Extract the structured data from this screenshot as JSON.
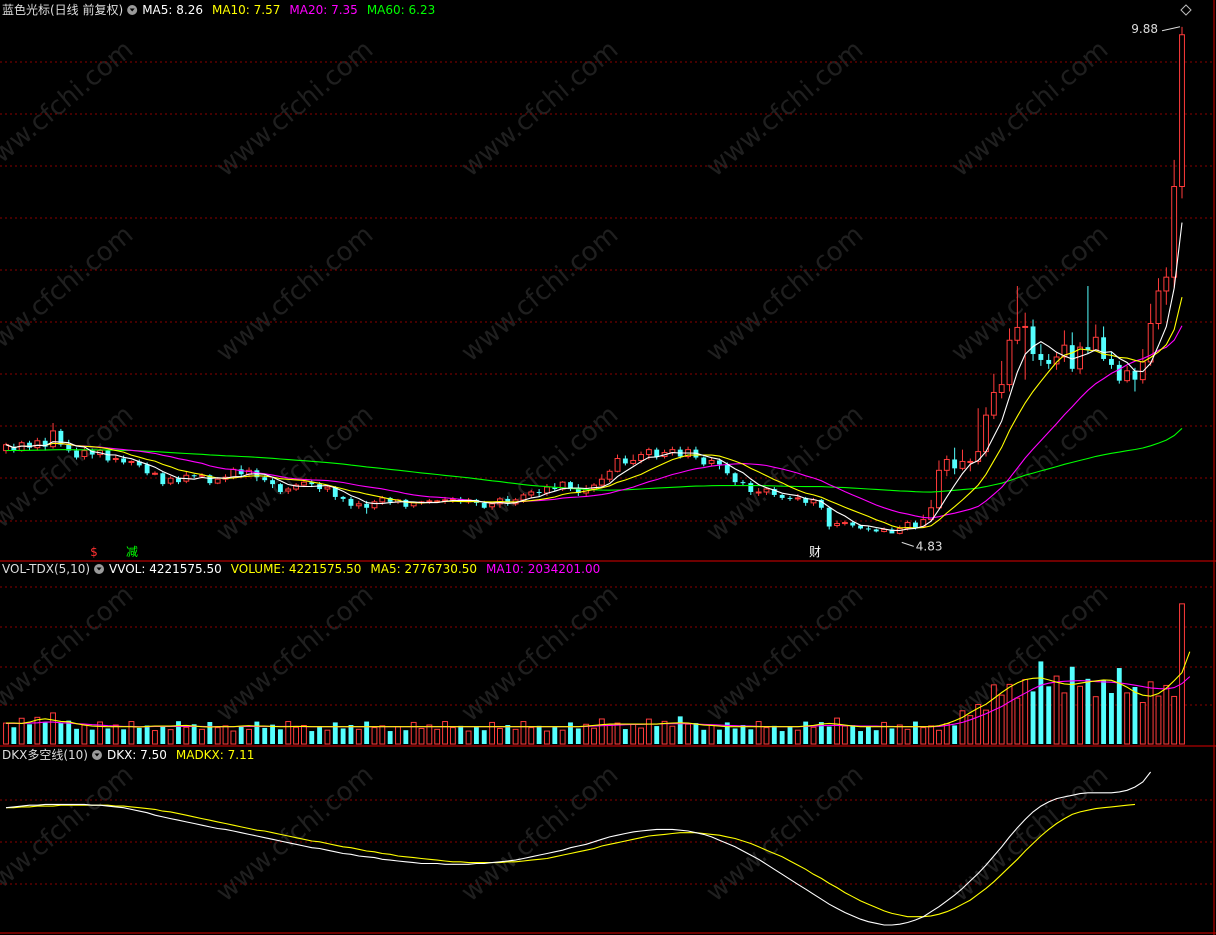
{
  "header": {
    "main": {
      "title": "蓝色光标(日线 前复权)",
      "items": [
        {
          "label": "MA5: 8.26",
          "color": "#ffffff"
        },
        {
          "label": "MA10: 7.57",
          "color": "#ffff00"
        },
        {
          "label": "MA20: 7.35",
          "color": "#ff00ff"
        },
        {
          "label": "MA60: 6.23",
          "color": "#00ff00"
        }
      ]
    },
    "volume": {
      "title": "VOL-TDX(5,10)",
      "items": [
        {
          "label": "VVOL: 4221575.50",
          "color": "#ffffff"
        },
        {
          "label": "VOLUME: 4221575.50",
          "color": "#ffff00"
        },
        {
          "label": "MA5: 2776730.50",
          "color": "#ffff00"
        },
        {
          "label": "MA10: 2034201.00",
          "color": "#ff00ff"
        }
      ]
    },
    "dkx": {
      "title": "DKX多空线(10)",
      "items": [
        {
          "label": "DKX: 7.50",
          "color": "#ffffff"
        },
        {
          "label": "MADKX: 7.11",
          "color": "#ffff00"
        }
      ]
    }
  },
  "annotations": {
    "high_label": "9.88",
    "low_label": "4.83",
    "markers": [
      {
        "text": "$",
        "color": "#ff3030"
      },
      {
        "text": "减",
        "color": "#00ff00"
      },
      {
        "text": "财",
        "color": "#ffffff"
      }
    ]
  },
  "watermark": "www.cfchi.com",
  "chart_data": {
    "type": "candlestick",
    "title": "蓝色光标(日线 前复权)",
    "high": 9.88,
    "low": 4.83,
    "ma_latest": {
      "MA5": 8.26,
      "MA10": 7.57,
      "MA20": 7.35,
      "MA60": 6.23
    },
    "volume_latest": {
      "VVOL": 4221575.5,
      "VOLUME": 4221575.5,
      "MA5": 2776730.5,
      "MA10": 2034201.0
    },
    "dkx_latest": {
      "DKX": 7.5,
      "MADKX": 7.11
    },
    "candles": [
      [
        5.66,
        5.72,
        5.63,
        5.74
      ],
      [
        5.7,
        5.66,
        5.64,
        5.73
      ],
      [
        5.66,
        5.74,
        5.65,
        5.76
      ],
      [
        5.74,
        5.69,
        5.66,
        5.76
      ],
      [
        5.69,
        5.76,
        5.66,
        5.79
      ],
      [
        5.76,
        5.7,
        5.66,
        5.79
      ],
      [
        5.7,
        5.86,
        5.68,
        5.94
      ],
      [
        5.86,
        5.72,
        5.7,
        5.88
      ],
      [
        5.72,
        5.66,
        5.64,
        5.77
      ],
      [
        5.66,
        5.59,
        5.57,
        5.69
      ],
      [
        5.6,
        5.66,
        5.57,
        5.69
      ],
      [
        5.66,
        5.62,
        5.58,
        5.68
      ],
      [
        5.62,
        5.66,
        5.59,
        5.68
      ],
      [
        5.66,
        5.56,
        5.54,
        5.67
      ],
      [
        5.57,
        5.58,
        5.54,
        5.61
      ],
      [
        5.58,
        5.54,
        5.52,
        5.61
      ],
      [
        5.54,
        5.55,
        5.51,
        5.56
      ],
      [
        5.55,
        5.51,
        5.49,
        5.57
      ],
      [
        5.52,
        5.43,
        5.41,
        5.54
      ],
      [
        5.43,
        5.43,
        5.41,
        5.45
      ],
      [
        5.43,
        5.32,
        5.3,
        5.44
      ],
      [
        5.33,
        5.38,
        5.31,
        5.4
      ],
      [
        5.38,
        5.34,
        5.32,
        5.4
      ],
      [
        5.35,
        5.41,
        5.33,
        5.45
      ],
      [
        5.41,
        5.4,
        5.38,
        5.42
      ],
      [
        5.4,
        5.41,
        5.38,
        5.43
      ],
      [
        5.41,
        5.33,
        5.31,
        5.42
      ],
      [
        5.33,
        5.37,
        5.32,
        5.39
      ],
      [
        5.37,
        5.39,
        5.34,
        5.42
      ],
      [
        5.39,
        5.47,
        5.37,
        5.49
      ],
      [
        5.47,
        5.42,
        5.39,
        5.51
      ],
      [
        5.42,
        5.46,
        5.39,
        5.49
      ],
      [
        5.46,
        5.39,
        5.35,
        5.48
      ],
      [
        5.39,
        5.36,
        5.34,
        5.41
      ],
      [
        5.36,
        5.32,
        5.28,
        5.38
      ],
      [
        5.32,
        5.24,
        5.22,
        5.33
      ],
      [
        5.25,
        5.27,
        5.22,
        5.29
      ],
      [
        5.27,
        5.31,
        5.25,
        5.33
      ],
      [
        5.31,
        5.34,
        5.29,
        5.36
      ],
      [
        5.34,
        5.32,
        5.29,
        5.36
      ],
      [
        5.32,
        5.27,
        5.24,
        5.34
      ],
      [
        5.27,
        5.29,
        5.24,
        5.31
      ],
      [
        5.29,
        5.19,
        5.16,
        5.3
      ],
      [
        5.19,
        5.17,
        5.14,
        5.2
      ],
      [
        5.17,
        5.1,
        5.07,
        5.19
      ],
      [
        5.1,
        5.12,
        5.07,
        5.15
      ],
      [
        5.12,
        5.08,
        5.02,
        5.15
      ],
      [
        5.08,
        5.14,
        5.06,
        5.16
      ],
      [
        5.14,
        5.18,
        5.11,
        5.2
      ],
      [
        5.18,
        5.14,
        5.11,
        5.19
      ],
      [
        5.14,
        5.16,
        5.12,
        5.17
      ],
      [
        5.16,
        5.09,
        5.07,
        5.17
      ],
      [
        5.1,
        5.13,
        5.08,
        5.14
      ],
      [
        5.13,
        5.14,
        5.11,
        5.15
      ],
      [
        5.14,
        5.15,
        5.12,
        5.17
      ],
      [
        5.15,
        5.15,
        5.13,
        5.16
      ],
      [
        5.15,
        5.16,
        5.12,
        5.19
      ],
      [
        5.16,
        5.17,
        5.13,
        5.19
      ],
      [
        5.17,
        5.14,
        5.12,
        5.19
      ],
      [
        5.14,
        5.16,
        5.12,
        5.18
      ],
      [
        5.16,
        5.13,
        5.1,
        5.17
      ],
      [
        5.13,
        5.08,
        5.07,
        5.15
      ],
      [
        5.09,
        5.12,
        5.06,
        5.14
      ],
      [
        5.12,
        5.17,
        5.08,
        5.19
      ],
      [
        5.17,
        5.12,
        5.1,
        5.2
      ],
      [
        5.12,
        5.16,
        5.1,
        5.18
      ],
      [
        5.16,
        5.21,
        5.13,
        5.23
      ],
      [
        5.21,
        5.24,
        5.18,
        5.26
      ],
      [
        5.24,
        5.23,
        5.19,
        5.27
      ],
      [
        5.23,
        5.29,
        5.2,
        5.32
      ],
      [
        5.29,
        5.27,
        5.25,
        5.33
      ],
      [
        5.27,
        5.34,
        5.25,
        5.35
      ],
      [
        5.34,
        5.27,
        5.25,
        5.35
      ],
      [
        5.27,
        5.23,
        5.2,
        5.32
      ],
      [
        5.23,
        5.27,
        5.2,
        5.31
      ],
      [
        5.27,
        5.31,
        5.24,
        5.33
      ],
      [
        5.31,
        5.37,
        5.28,
        5.42
      ],
      [
        5.37,
        5.45,
        5.34,
        5.47
      ],
      [
        5.45,
        5.58,
        5.44,
        5.62
      ],
      [
        5.58,
        5.53,
        5.51,
        5.61
      ],
      [
        5.53,
        5.56,
        5.51,
        5.62
      ],
      [
        5.56,
        5.62,
        5.53,
        5.65
      ],
      [
        5.62,
        5.67,
        5.57,
        5.69
      ],
      [
        5.67,
        5.6,
        5.57,
        5.69
      ],
      [
        5.6,
        5.64,
        5.58,
        5.67
      ],
      [
        5.64,
        5.67,
        5.61,
        5.7
      ],
      [
        5.67,
        5.6,
        5.58,
        5.7
      ],
      [
        5.6,
        5.67,
        5.58,
        5.7
      ],
      [
        5.67,
        5.59,
        5.57,
        5.7
      ],
      [
        5.59,
        5.52,
        5.5,
        5.6
      ],
      [
        5.53,
        5.56,
        5.5,
        5.59
      ],
      [
        5.56,
        5.52,
        5.47,
        5.58
      ],
      [
        5.52,
        5.43,
        5.41,
        5.54
      ],
      [
        5.43,
        5.34,
        5.31,
        5.44
      ],
      [
        5.34,
        5.33,
        5.3,
        5.36
      ],
      [
        5.33,
        5.24,
        5.21,
        5.35
      ],
      [
        5.24,
        5.24,
        5.2,
        5.28
      ],
      [
        5.24,
        5.27,
        5.21,
        5.29
      ],
      [
        5.27,
        5.21,
        5.19,
        5.29
      ],
      [
        5.21,
        5.18,
        5.16,
        5.22
      ],
      [
        5.18,
        5.17,
        5.15,
        5.2
      ],
      [
        5.17,
        5.18,
        5.15,
        5.22
      ],
      [
        5.18,
        5.13,
        5.1,
        5.19
      ],
      [
        5.13,
        5.16,
        5.1,
        5.18
      ],
      [
        5.16,
        5.08,
        5.06,
        5.17
      ],
      [
        5.08,
        4.89,
        4.86,
        5.09
      ],
      [
        4.9,
        4.92,
        4.88,
        4.95
      ],
      [
        4.92,
        4.93,
        4.9,
        4.95
      ],
      [
        4.93,
        4.9,
        4.88,
        4.95
      ],
      [
        4.9,
        4.87,
        4.86,
        4.91
      ],
      [
        4.87,
        4.86,
        4.84,
        4.89
      ],
      [
        4.86,
        4.84,
        4.83,
        4.87
      ],
      [
        4.84,
        4.86,
        4.83,
        4.88
      ],
      [
        4.86,
        4.82,
        4.83,
        4.88
      ],
      [
        4.82,
        4.87,
        4.81,
        4.9
      ],
      [
        4.87,
        4.93,
        4.85,
        4.95
      ],
      [
        4.93,
        4.88,
        4.86,
        4.95
      ],
      [
        4.89,
        4.96,
        4.88,
        5.01
      ],
      [
        4.96,
        5.08,
        4.94,
        5.16
      ],
      [
        5.08,
        5.46,
        5.06,
        5.56
      ],
      [
        5.46,
        5.57,
        5.4,
        5.61
      ],
      [
        5.57,
        5.48,
        5.42,
        5.69
      ],
      [
        5.48,
        5.55,
        5.46,
        5.67
      ],
      [
        5.55,
        5.55,
        5.45,
        5.58
      ],
      [
        5.55,
        5.65,
        5.52,
        6.09
      ],
      [
        5.65,
        6.02,
        5.6,
        6.1
      ],
      [
        6.02,
        6.25,
        5.98,
        6.44
      ],
      [
        6.25,
        6.33,
        6.19,
        6.57
      ],
      [
        6.33,
        6.78,
        6.26,
        6.9
      ],
      [
        6.78,
        6.91,
        6.74,
        7.33
      ],
      [
        6.91,
        6.92,
        6.38,
        7.06
      ],
      [
        6.92,
        6.64,
        6.57,
        6.99
      ],
      [
        6.64,
        6.58,
        6.52,
        6.74
      ],
      [
        6.58,
        6.54,
        6.49,
        6.64
      ],
      [
        6.54,
        6.61,
        6.48,
        6.66
      ],
      [
        6.61,
        6.73,
        6.56,
        6.88
      ],
      [
        6.73,
        6.49,
        6.46,
        6.86
      ],
      [
        6.49,
        6.71,
        6.44,
        6.76
      ],
      [
        6.71,
        6.68,
        6.64,
        7.33
      ],
      [
        6.68,
        6.81,
        6.67,
        6.94
      ],
      [
        6.81,
        6.59,
        6.57,
        6.92
      ],
      [
        6.59,
        6.53,
        6.49,
        6.66
      ],
      [
        6.53,
        6.37,
        6.34,
        6.57
      ],
      [
        6.37,
        6.47,
        6.35,
        6.52
      ],
      [
        6.47,
        6.38,
        6.26,
        6.5
      ],
      [
        6.38,
        6.56,
        6.34,
        6.69
      ],
      [
        6.56,
        6.95,
        6.52,
        7.15
      ],
      [
        6.95,
        7.28,
        6.89,
        7.41
      ],
      [
        7.28,
        7.42,
        7.14,
        7.52
      ],
      [
        7.42,
        8.34,
        7.31,
        8.61
      ],
      [
        8.34,
        9.88,
        8.22,
        9.96
      ]
    ],
    "vvol_ma5": [
      0.63,
      0.63,
      0.62,
      0.66,
      0.73,
      0.76,
      0.72,
      0.68,
      0.67,
      0.61,
      0.57,
      0.54,
      0.53,
      0.52,
      0.52,
      0.52,
      0.52,
      0.51,
      0.53,
      0.54,
      0.54,
      0.54,
      0.55,
      0.56,
      0.54,
      0.52,
      0.51,
      0.52,
      0.52,
      0.52,
      0.54,
      0.55,
      0.54,
      0.54,
      0.53,
      0.52,
      0.52,
      0.53,
      0.53,
      0.52,
      0.52,
      0.52,
      0.52,
      0.52,
      0.52,
      0.52,
      0.52,
      0.52,
      0.52,
      0.52,
      0.52,
      0.52,
      0.52,
      0.52,
      0.52,
      0.52,
      0.52,
      0.52,
      0.52,
      0.52,
      0.52,
      0.52,
      0.52,
      0.52,
      0.52,
      0.52,
      0.52,
      0.52,
      0.52,
      0.52,
      0.52,
      0.52,
      0.52,
      0.52,
      0.54,
      0.56,
      0.58,
      0.6,
      0.6,
      0.6,
      0.6,
      0.6,
      0.6,
      0.6,
      0.62,
      0.63,
      0.64,
      0.63,
      0.6,
      0.57,
      0.56,
      0.54,
      0.52,
      0.52,
      0.52,
      0.52,
      0.52,
      0.52,
      0.52,
      0.52,
      0.52,
      0.52,
      0.54,
      0.56,
      0.6,
      0.62,
      0.6,
      0.57,
      0.54,
      0.52,
      0.52,
      0.52,
      0.52,
      0.52,
      0.52,
      0.52,
      0.52,
      0.52,
      0.52,
      0.55,
      0.61,
      0.7,
      0.8,
      0.95,
      1.08,
      1.2,
      1.37,
      1.55,
      1.71,
      1.84,
      1.94,
      1.98,
      1.99,
      1.93,
      1.86,
      1.81,
      1.79,
      1.83,
      1.87,
      1.9,
      1.93,
      1.92,
      1.83,
      1.71,
      1.56,
      1.47,
      1.44,
      1.52,
      1.68,
      1.91,
      2.15,
      2.78
    ],
    "vvol_ma10": [
      0.62,
      0.62,
      0.62,
      0.63,
      0.64,
      0.66,
      0.66,
      0.64,
      0.63,
      0.61,
      0.6,
      0.58,
      0.57,
      0.55,
      0.54,
      0.53,
      0.53,
      0.52,
      0.52,
      0.53,
      0.53,
      0.53,
      0.53,
      0.53,
      0.53,
      0.53,
      0.52,
      0.52,
      0.52,
      0.52,
      0.53,
      0.53,
      0.53,
      0.53,
      0.53,
      0.53,
      0.53,
      0.53,
      0.52,
      0.52,
      0.52,
      0.52,
      0.52,
      0.52,
      0.52,
      0.52,
      0.52,
      0.52,
      0.52,
      0.52,
      0.52,
      0.52,
      0.52,
      0.52,
      0.52,
      0.52,
      0.52,
      0.52,
      0.52,
      0.52,
      0.52,
      0.52,
      0.52,
      0.52,
      0.52,
      0.52,
      0.52,
      0.52,
      0.52,
      0.52,
      0.52,
      0.52,
      0.52,
      0.52,
      0.53,
      0.54,
      0.55,
      0.56,
      0.57,
      0.58,
      0.59,
      0.59,
      0.6,
      0.6,
      0.61,
      0.61,
      0.61,
      0.61,
      0.6,
      0.59,
      0.58,
      0.57,
      0.56,
      0.55,
      0.54,
      0.54,
      0.53,
      0.52,
      0.52,
      0.52,
      0.52,
      0.52,
      0.53,
      0.54,
      0.55,
      0.56,
      0.56,
      0.55,
      0.55,
      0.54,
      0.54,
      0.54,
      0.53,
      0.53,
      0.52,
      0.52,
      0.52,
      0.52,
      0.52,
      0.53,
      0.56,
      0.6,
      0.65,
      0.73,
      0.82,
      0.91,
      1.02,
      1.13,
      1.27,
      1.41,
      1.53,
      1.66,
      1.77,
      1.83,
      1.87,
      1.89,
      1.9,
      1.91,
      1.9,
      1.88,
      1.87,
      1.86,
      1.84,
      1.81,
      1.77,
      1.73,
      1.69,
      1.67,
      1.66,
      1.7,
      1.82,
      2.03
    ],
    "dkx": [
      7.07,
      7.08,
      7.09,
      7.1,
      7.1,
      7.11,
      7.11,
      7.11,
      7.11,
      7.11,
      7.11,
      7.1,
      7.1,
      7.09,
      7.08,
      7.07,
      7.05,
      7.03,
      7.01,
      6.98,
      6.96,
      6.94,
      6.92,
      6.9,
      6.88,
      6.86,
      6.84,
      6.82,
      6.81,
      6.79,
      6.77,
      6.75,
      6.73,
      6.71,
      6.69,
      6.67,
      6.65,
      6.63,
      6.61,
      6.59,
      6.58,
      6.56,
      6.54,
      6.52,
      6.51,
      6.49,
      6.48,
      6.47,
      6.45,
      6.44,
      6.43,
      6.42,
      6.41,
      6.4,
      6.4,
      6.4,
      6.39,
      6.39,
      6.39,
      6.39,
      6.4,
      6.4,
      6.41,
      6.42,
      6.43,
      6.44,
      6.46,
      6.48,
      6.5,
      6.52,
      6.54,
      6.56,
      6.59,
      6.61,
      6.63,
      6.66,
      6.69,
      6.72,
      6.74,
      6.76,
      6.78,
      6.79,
      6.8,
      6.81,
      6.81,
      6.81,
      6.8,
      6.79,
      6.77,
      6.75,
      6.72,
      6.68,
      6.64,
      6.6,
      6.55,
      6.5,
      6.45,
      6.39,
      6.33,
      6.27,
      6.21,
      6.15,
      6.09,
      6.03,
      5.97,
      5.91,
      5.86,
      5.81,
      5.77,
      5.73,
      5.7,
      5.68,
      5.66,
      5.66,
      5.67,
      5.69,
      5.72,
      5.76,
      5.82,
      5.88,
      5.95,
      6.02,
      6.1,
      6.19,
      6.28,
      6.38,
      6.49,
      6.6,
      6.72,
      6.83,
      6.93,
      7.02,
      7.09,
      7.14,
      7.18,
      7.2,
      7.22,
      7.24,
      7.25,
      7.25,
      7.25,
      7.25,
      7.26,
      7.28,
      7.32,
      7.38,
      7.5
    ],
    "madkx": [
      7.07,
      7.07,
      7.08,
      7.08,
      7.09,
      7.09,
      7.09,
      7.1,
      7.1,
      7.1,
      7.1,
      7.1,
      7.1,
      7.1,
      7.09,
      7.09,
      7.08,
      7.07,
      7.06,
      7.05,
      7.03,
      7.02,
      7.0,
      6.98,
      6.96,
      6.94,
      6.92,
      6.9,
      6.88,
      6.86,
      6.84,
      6.82,
      6.8,
      6.79,
      6.77,
      6.75,
      6.73,
      6.71,
      6.69,
      6.67,
      6.66,
      6.64,
      6.62,
      6.6,
      6.59,
      6.57,
      6.55,
      6.54,
      6.52,
      6.51,
      6.49,
      6.48,
      6.47,
      6.46,
      6.45,
      6.44,
      6.43,
      6.42,
      6.42,
      6.41,
      6.41,
      6.41,
      6.41,
      6.41,
      6.42,
      6.42,
      6.43,
      6.44,
      6.45,
      6.46,
      6.48,
      6.5,
      6.52,
      6.54,
      6.56,
      6.58,
      6.61,
      6.63,
      6.65,
      6.67,
      6.69,
      6.71,
      6.73,
      6.74,
      6.75,
      6.76,
      6.77,
      6.77,
      6.77,
      6.76,
      6.75,
      6.74,
      6.72,
      6.7,
      6.67,
      6.64,
      6.6,
      6.56,
      6.52,
      6.48,
      6.43,
      6.38,
      6.33,
      6.27,
      6.22,
      6.16,
      6.11,
      6.05,
      6.0,
      5.95,
      5.91,
      5.87,
      5.83,
      5.8,
      5.78,
      5.76,
      5.76,
      5.76,
      5.77,
      5.79,
      5.82,
      5.86,
      5.91,
      5.96,
      6.03,
      6.1,
      6.18,
      6.27,
      6.36,
      6.45,
      6.55,
      6.64,
      6.73,
      6.81,
      6.88,
      6.94,
      6.99,
      7.02,
      7.04,
      7.06,
      7.07,
      7.08,
      7.09,
      7.1,
      7.11
    ]
  }
}
